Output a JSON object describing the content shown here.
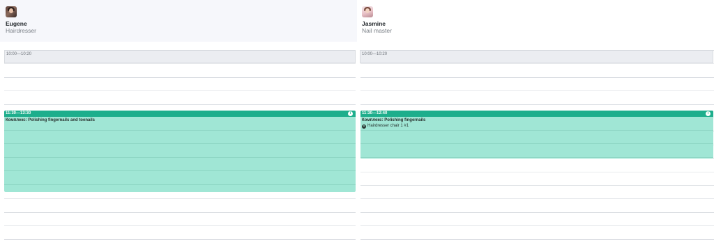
{
  "staff": [
    {
      "name": "Eugene",
      "role": "Hairdresser",
      "blocked": {
        "time": "10:00—10:20"
      },
      "appointment": {
        "time": "11:30—13:30",
        "title": "Комплекс: Polishing fingernails and toenails",
        "resource": ""
      }
    },
    {
      "name": "Jasmine",
      "role": "Nail master",
      "blocked": {
        "time": "10:00—10:20"
      },
      "appointment": {
        "time": "11:30—12:40",
        "title": "Комплекс: Polishing fingernails",
        "resource": "Hairdresser chair 1 #1"
      }
    }
  ],
  "colors": {
    "appointment_header": "#1dae8c",
    "appointment_body": "#a0e6d5",
    "blocked_slot": "#ebedf1",
    "header_bg": "#f6f7fb"
  },
  "icons": {
    "appointment_info": "info-icon",
    "resource": "chair-icon"
  }
}
